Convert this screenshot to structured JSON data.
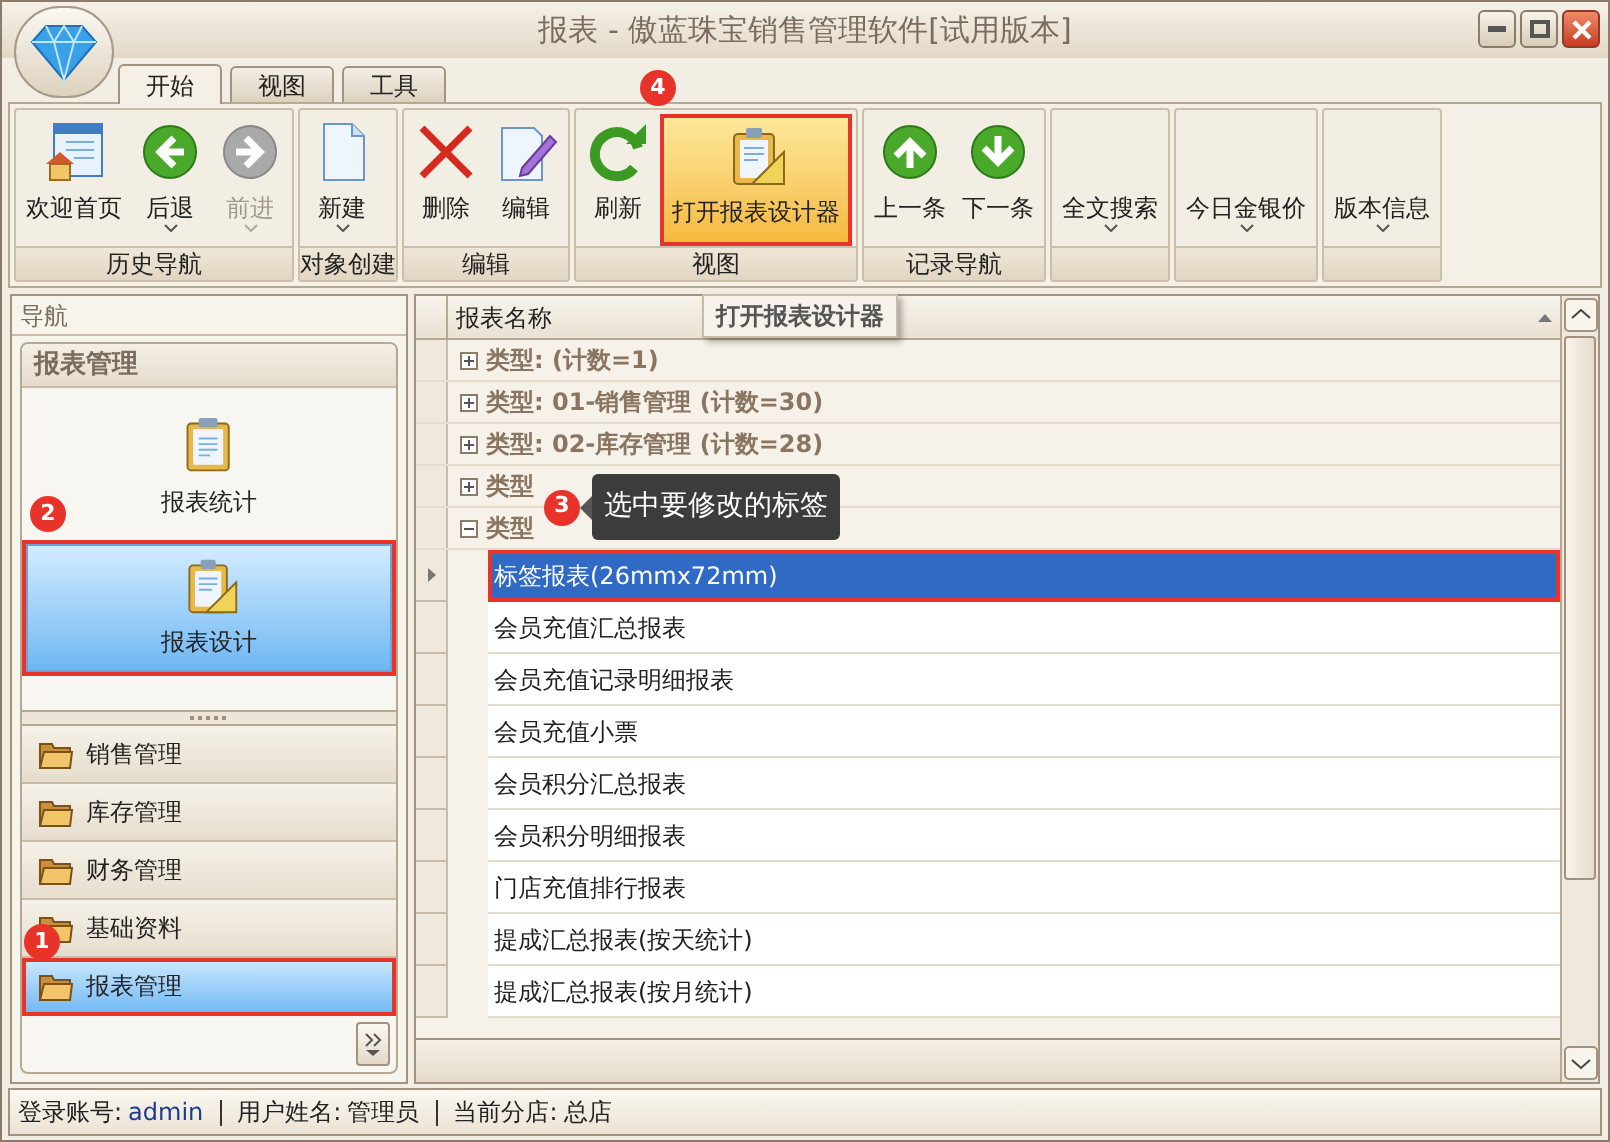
{
  "window": {
    "title": "报表 - 傲蓝珠宝销售管理软件[试用版本]"
  },
  "tabs": [
    {
      "label": "开始",
      "selected": true
    },
    {
      "label": "视图",
      "selected": false
    },
    {
      "label": "工具",
      "selected": false
    }
  ],
  "ribbon": {
    "groups": [
      {
        "label": "历史导航",
        "buttons": [
          {
            "label": "欢迎首页",
            "kind": "home",
            "disabled": false,
            "dropdown": false
          },
          {
            "label": "后退",
            "kind": "back",
            "disabled": false,
            "dropdown": true
          },
          {
            "label": "前进",
            "kind": "forward",
            "disabled": true,
            "dropdown": true
          }
        ]
      },
      {
        "label": "对象创建",
        "buttons": [
          {
            "label": "新建",
            "kind": "new",
            "disabled": false,
            "dropdown": true
          }
        ]
      },
      {
        "label": "编辑",
        "buttons": [
          {
            "label": "删除",
            "kind": "delete",
            "disabled": false,
            "dropdown": false
          },
          {
            "label": "编辑",
            "kind": "edit",
            "disabled": false,
            "dropdown": false
          }
        ]
      },
      {
        "label": "视图",
        "buttons": [
          {
            "label": "刷新",
            "kind": "refresh",
            "disabled": false,
            "dropdown": false
          },
          {
            "label": "打开报表设计器",
            "kind": "designer",
            "disabled": false,
            "dropdown": false,
            "highlighted": true,
            "marker": "4"
          }
        ]
      },
      {
        "label": "记录导航",
        "buttons": [
          {
            "label": "上一条",
            "kind": "up",
            "disabled": false,
            "dropdown": false
          },
          {
            "label": "下一条",
            "kind": "down",
            "disabled": false,
            "dropdown": false
          }
        ]
      },
      {
        "buttons": [
          {
            "label": "全文搜索",
            "kind": "text",
            "disabled": false,
            "dropdown": true
          }
        ]
      },
      {
        "buttons": [
          {
            "label": "今日金银价",
            "kind": "text",
            "disabled": false,
            "dropdown": true
          }
        ]
      },
      {
        "buttons": [
          {
            "label": "版本信息",
            "kind": "text",
            "disabled": false,
            "dropdown": true
          }
        ]
      }
    ]
  },
  "navigation": {
    "header": "导航",
    "panel_title": "报表管理",
    "items": [
      {
        "label": "报表统计",
        "kind": "report",
        "selected": false
      },
      {
        "label": "报表设计",
        "kind": "design",
        "selected": true,
        "marker": "2"
      }
    ],
    "folders": [
      {
        "label": "销售管理",
        "selected": false
      },
      {
        "label": "库存管理",
        "selected": false
      },
      {
        "label": "财务管理",
        "selected": false
      },
      {
        "label": "基础资料",
        "selected": false
      },
      {
        "label": "报表管理",
        "selected": true,
        "marker": "1"
      }
    ]
  },
  "grid": {
    "column": "报表名称",
    "tooltip": "打开报表设计器",
    "groups": [
      {
        "label": "类型: (计数=1)",
        "expanded": false
      },
      {
        "label": "类型: 01-销售管理 (计数=30)",
        "expanded": false
      },
      {
        "label": "类型: 02-库存管理 (计数=28)",
        "expanded": false
      },
      {
        "label": "类型",
        "expanded": false
      },
      {
        "label": "类型",
        "expanded": true
      }
    ],
    "rows": [
      {
        "name": "标签报表(26mmx72mm)",
        "selected": true
      },
      {
        "name": "会员充值汇总报表",
        "selected": false
      },
      {
        "name": "会员充值记录明细报表",
        "selected": false
      },
      {
        "name": "会员充值小票",
        "selected": false
      },
      {
        "name": "会员积分汇总报表",
        "selected": false
      },
      {
        "name": "会员积分明细报表",
        "selected": false
      },
      {
        "name": "门店充值排行报表",
        "selected": false
      },
      {
        "name": "提成汇总报表(按天统计)",
        "selected": false
      },
      {
        "name": "提成汇总报表(按月统计)",
        "selected": false
      }
    ],
    "callout": {
      "text": "选中要修改的标签",
      "marker": "3"
    }
  },
  "status_bar": [
    {
      "label": "登录账号:",
      "value": "admin"
    },
    {
      "label": "用户姓名:",
      "value": "管理员"
    },
    {
      "label": "当前分店:",
      "value": "总店"
    }
  ]
}
